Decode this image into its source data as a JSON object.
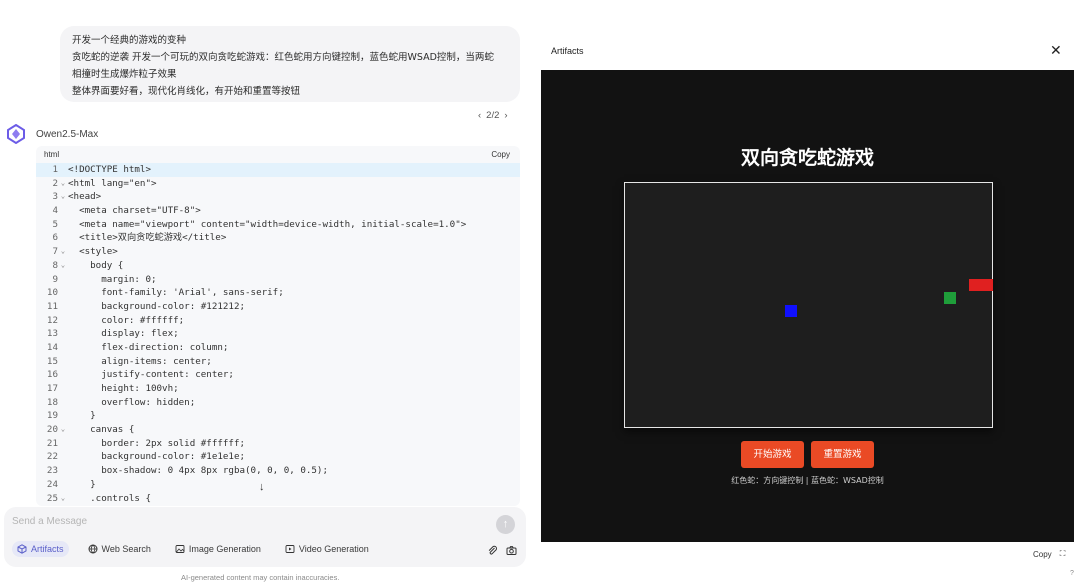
{
  "user_message": {
    "lines": [
      "开发一个经典的游戏的变种",
      "贪吃蛇的逆袭 开发一个可玩的双向贪吃蛇游戏：红色蛇用方向键控制，蓝色蛇用WSAD控制，当两蛇",
      "相撞时生成爆炸粒子效果",
      "整体界面要好看，现代化肖线化，有开始和重置等按钮"
    ]
  },
  "pager": {
    "prev": "‹",
    "label": "2/2",
    "next": "›"
  },
  "assistant": {
    "name": "Owen2.5-Max"
  },
  "code_block": {
    "language": "html",
    "copy_label": "Copy",
    "lines": [
      {
        "n": "1",
        "fold": "",
        "text": "<!DOCTYPE html>"
      },
      {
        "n": "2",
        "fold": "⌄",
        "text": "<html lang=\"en\">"
      },
      {
        "n": "3",
        "fold": "⌄",
        "text": "<head>"
      },
      {
        "n": "4",
        "fold": "",
        "text": "  <meta charset=\"UTF-8\">"
      },
      {
        "n": "5",
        "fold": "",
        "text": "  <meta name=\"viewport\" content=\"width=device-width, initial-scale=1.0\">"
      },
      {
        "n": "6",
        "fold": "",
        "text": "  <title>双向贪吃蛇游戏</title>"
      },
      {
        "n": "7",
        "fold": "⌄",
        "text": "  <style>"
      },
      {
        "n": "8",
        "fold": "⌄",
        "text": "    body {"
      },
      {
        "n": "9",
        "fold": "",
        "text": "      margin: 0;"
      },
      {
        "n": "10",
        "fold": "",
        "text": "      font-family: 'Arial', sans-serif;"
      },
      {
        "n": "11",
        "fold": "",
        "text": "      background-color: #121212;"
      },
      {
        "n": "12",
        "fold": "",
        "text": "      color: #ffffff;"
      },
      {
        "n": "13",
        "fold": "",
        "text": "      display: flex;"
      },
      {
        "n": "14",
        "fold": "",
        "text": "      flex-direction: column;"
      },
      {
        "n": "15",
        "fold": "",
        "text": "      align-items: center;"
      },
      {
        "n": "16",
        "fold": "",
        "text": "      justify-content: center;"
      },
      {
        "n": "17",
        "fold": "",
        "text": "      height: 100vh;"
      },
      {
        "n": "18",
        "fold": "",
        "text": "      overflow: hidden;"
      },
      {
        "n": "19",
        "fold": "",
        "text": "    }"
      },
      {
        "n": "20",
        "fold": "⌄",
        "text": "    canvas {"
      },
      {
        "n": "21",
        "fold": "",
        "text": "      border: 2px solid #ffffff;"
      },
      {
        "n": "22",
        "fold": "",
        "text": "      background-color: #1e1e1e;"
      },
      {
        "n": "23",
        "fold": "",
        "text": "      box-shadow: 0 4px 8px rgba(0, 0, 0, 0.5);"
      },
      {
        "n": "24",
        "fold": "",
        "text": "    }"
      },
      {
        "n": "25",
        "fold": "⌄",
        "text": "    .controls {"
      }
    ]
  },
  "input": {
    "placeholder": "Send a Message",
    "tools": [
      "Artifacts",
      "Web Search",
      "Image Generation",
      "Video Generation"
    ]
  },
  "disclaimer": "AI-generated content may contain inaccuracies.",
  "artifacts": {
    "title": "Artifacts",
    "game": {
      "title": "双向贪吃蛇游戏",
      "start_label": "开始游戏",
      "reset_label": "重置游戏",
      "hint": "红色蛇：方向键控制 | 蓝色蛇：WSAD控制",
      "colors": {
        "red_snake": "#e02020",
        "blue_snake": "#1010ff",
        "food": "#1f9e3a",
        "button": "#ea4a25"
      }
    },
    "footer_copy": "Copy"
  }
}
